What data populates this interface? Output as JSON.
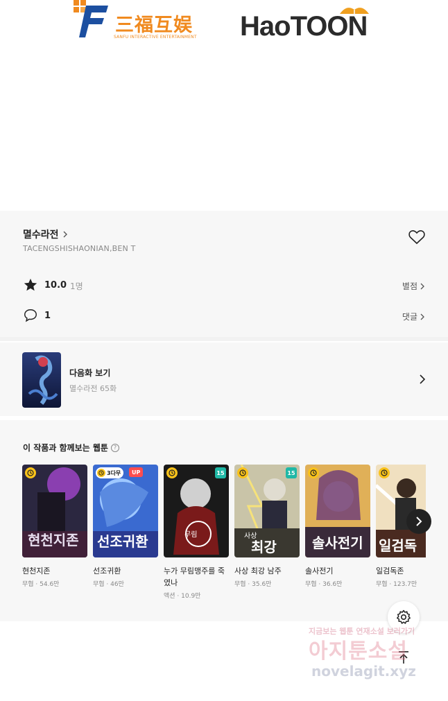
{
  "logos": {
    "sanfu_cn": "三福互娱",
    "sanfu_en": "SANFU INTERACTIVE ENTERTAINMENT",
    "haotoon": "HaoTOON"
  },
  "work": {
    "title": "멸수라전",
    "author": "TACENGSHISHAONIAN,BEN T",
    "rating": "10.0",
    "rating_count": "1명",
    "rating_link": "별점",
    "comments": "1",
    "comments_link": "댓글"
  },
  "next_episode": {
    "label": "다음화 보기",
    "subtitle": "멸수라전 65화"
  },
  "recommend": {
    "title": "이 작품과 함께보는 웹툰",
    "items": [
      {
        "name": "현천지존",
        "meta": "무협 · 54.6만",
        "badges": [
          "clock"
        ]
      },
      {
        "name": "선조귀환",
        "meta": "무협 · 46만",
        "badges": [
          "days",
          "up"
        ],
        "days_label": "3다무",
        "up_label": "UP"
      },
      {
        "name": "누가 무림맹주를 죽였나",
        "meta": "액션 · 10.9만",
        "badges": [
          "clock",
          "age"
        ],
        "age_label": "15"
      },
      {
        "name": "사상 최강 남주",
        "meta": "무협 · 35.6만",
        "badges": [
          "clock",
          "age"
        ],
        "age_label": "15"
      },
      {
        "name": "솔사전기",
        "meta": "무협 · 36.6만",
        "badges": [
          "clock"
        ]
      },
      {
        "name": "일검독존",
        "meta": "무협 · 123.7만",
        "badges": [
          "clock"
        ]
      }
    ]
  },
  "watermark": {
    "line1": "지금보는 웹툰 연재소설 보러가기",
    "line2": "아지툰소설",
    "line3": "novelagit.xyz"
  },
  "icons": [
    "heart-icon",
    "star-icon",
    "comment-icon",
    "chevron-right-icon",
    "help-icon",
    "clock-icon",
    "gear-icon",
    "arrow-up-icon"
  ],
  "colors": {
    "badge_yellow": "#f9c21a",
    "badge_up": "#ff4d4f",
    "badge_age": "#1fb8a6",
    "brand_orange": "#f08a1f",
    "brand_blue": "#1c4fa0"
  }
}
